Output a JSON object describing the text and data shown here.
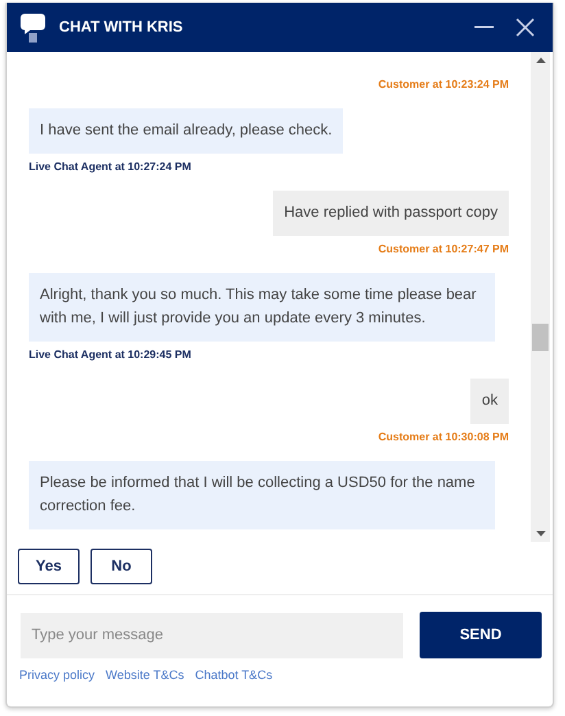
{
  "header": {
    "title": "CHAT WITH KRIS"
  },
  "messages": [
    {
      "kind": "customer_meta",
      "meta": "Customer at 10:23:24 PM"
    },
    {
      "kind": "agent",
      "text": "I have sent the email already, please check.",
      "meta": "Live Chat Agent at 10:27:24 PM"
    },
    {
      "kind": "customer",
      "text": "Have replied with passport copy",
      "meta": "Customer at 10:27:47 PM"
    },
    {
      "kind": "agent",
      "text": "Alright, thank you so much. This may take some time please bear with me, I will just provide you an update every 3 minutes.",
      "meta": "Live Chat Agent at 10:29:45 PM"
    },
    {
      "kind": "customer",
      "text": "ok",
      "meta": "Customer at 10:30:08 PM"
    },
    {
      "kind": "agent",
      "text": "Please be informed that I will be collecting a USD50 for the name correction fee."
    }
  ],
  "quick_replies": [
    "Yes",
    "No"
  ],
  "composer": {
    "placeholder": "Type your message",
    "send": "SEND"
  },
  "links": [
    "Privacy policy",
    "Website T&Cs",
    "Chatbot T&Cs"
  ]
}
